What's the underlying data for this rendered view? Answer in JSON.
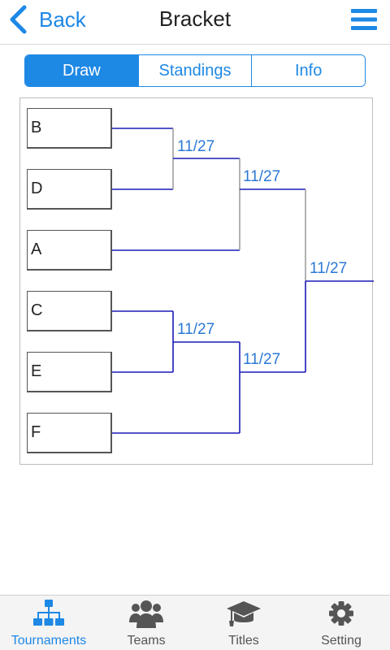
{
  "header": {
    "back_label": "Back",
    "title": "Bracket"
  },
  "segments": [
    {
      "label": "Draw",
      "active": true
    },
    {
      "label": "Standings",
      "active": false
    },
    {
      "label": "Info",
      "active": false
    }
  ],
  "bracket": {
    "teams": [
      "B",
      "D",
      "A",
      "C",
      "E",
      "F"
    ],
    "match_dates": [
      "11/27",
      "11/27",
      "11/27",
      "11/27",
      "11/27"
    ]
  },
  "tabs": [
    {
      "label": "Tournaments",
      "icon": "tournaments-icon",
      "active": true
    },
    {
      "label": "Teams",
      "icon": "teams-icon",
      "active": false
    },
    {
      "label": "Titles",
      "icon": "graduation-cap-icon",
      "active": false
    },
    {
      "label": "Setting",
      "icon": "gear-icon",
      "active": false
    }
  ],
  "colors": {
    "accent": "#1e88e5",
    "bracket_line": "#1a1ab8",
    "connector_gray": "#9e9e9e"
  }
}
